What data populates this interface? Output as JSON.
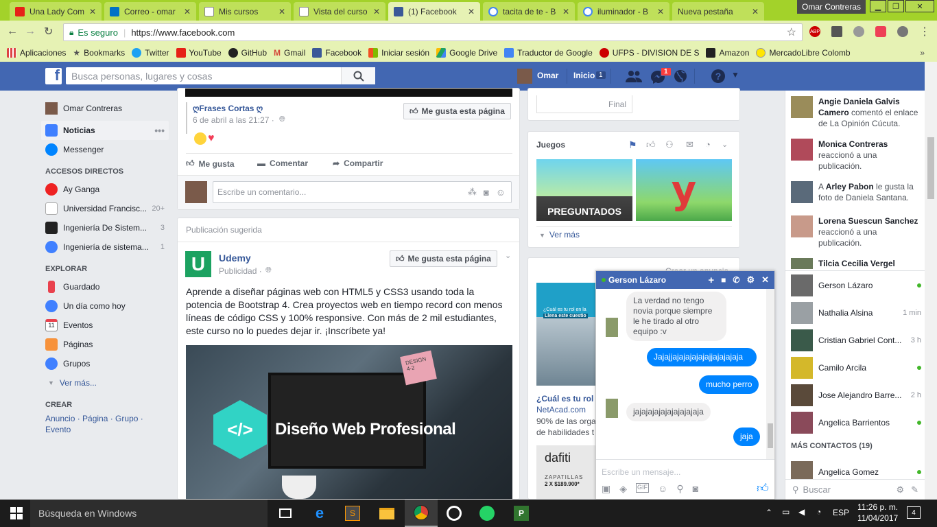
{
  "browser": {
    "tabs": [
      {
        "title": "Una Lady Com",
        "color": "#e62117"
      },
      {
        "title": "Correo - omar",
        "color": "#0072c6"
      },
      {
        "title": "Mis cursos",
        "color": "#ffffff"
      },
      {
        "title": "Vista del curso",
        "color": "#ffffff"
      },
      {
        "title": "(1) Facebook",
        "color": "#3b5998"
      },
      {
        "title": "tacita de te - B",
        "color": "#ffffff"
      },
      {
        "title": "iluminador - B",
        "color": "#ffffff"
      },
      {
        "title": "Nueva pestaña",
        "color": "#a3d22a"
      }
    ],
    "profile": "Omar Contreras",
    "secure_label": "Es seguro",
    "url": "https://www.facebook.com",
    "bookmarks": [
      {
        "label": "Aplicaciones",
        "color": "#d44"
      },
      {
        "label": "Bookmarks",
        "color": "#555"
      },
      {
        "label": "Twitter",
        "color": "#1da1f2"
      },
      {
        "label": "YouTube",
        "color": "#e62117"
      },
      {
        "label": "GitHub",
        "color": "#222"
      },
      {
        "label": "Gmail",
        "color": "#d44638"
      },
      {
        "label": "Facebook",
        "color": "#3b5998"
      },
      {
        "label": "Iniciar sesión",
        "color": "#f25022"
      },
      {
        "label": "Google Drive",
        "color": "#1fa463"
      },
      {
        "label": "Traductor de Google",
        "color": "#4285f4"
      },
      {
        "label": "UFPS - DIVISION DE S",
        "color": "#c00"
      },
      {
        "label": "Amazon",
        "color": "#222"
      },
      {
        "label": "MercadoLibre Colomb",
        "color": "#ffe600"
      }
    ]
  },
  "fb": {
    "search_placeholder": "Busca personas, lugares y cosas",
    "user": "Omar",
    "home": "Inicio",
    "home_count": "1",
    "msg_count": "1"
  },
  "leftnav": {
    "profile": "Omar Contreras",
    "news": "Noticias",
    "messenger": "Messenger",
    "shortcuts_title": "ACCESOS DIRECTOS",
    "shortcuts": [
      {
        "label": "Ay Ganga",
        "count": ""
      },
      {
        "label": "Universidad Francisc...",
        "count": "20+"
      },
      {
        "label": "Ingeniería De Sistem...",
        "count": "3"
      },
      {
        "label": "Ingeniería de sistema...",
        "count": "1"
      }
    ],
    "explore_title": "EXPLORAR",
    "explore": [
      {
        "label": "Guardado"
      },
      {
        "label": "Un día como hoy"
      },
      {
        "label": "Eventos"
      },
      {
        "label": "Páginas"
      },
      {
        "label": "Grupos"
      }
    ],
    "more": "Ver más...",
    "create_title": "CREAR",
    "create_links": "Anuncio · Página · Grupo · Evento"
  },
  "post1": {
    "page": "ღFrases Cortas ღ",
    "date": "6 de abril a las 21:27 ·",
    "like_page": "Me gusta esta página",
    "like": "Me gusta",
    "comment": "Comentar",
    "share": "Compartir",
    "comment_placeholder": "Escribe un comentario..."
  },
  "post2": {
    "label": "Publicación sugerida",
    "page": "Udemy",
    "sponsored": "Publicidad ·",
    "like_page": "Me gusta esta página",
    "text": "Aprende a diseñar páginas web con HTML5 y CSS3 usando toda la potencia de Bootstrap 4. Crea proyectos web en tiempo record con menos líneas de código CSS y 100% responsive. Con más de 2 mil estudiantes, este curso no lo puedes dejar ir. ¡Inscríbete ya!",
    "image_title": "Diseño Web Profesional",
    "sticky_note": "DESIGN 4-2"
  },
  "right": {
    "final_label": "Final",
    "games_title": "Juegos",
    "game1": "PREGUNTADOS",
    "game2": "y",
    "see_more": "Ver más",
    "create_ad": "Crear un anuncio",
    "ad_img_text1": "¿Cuál es tu rol en la",
    "ad_img_text2": "Llena este cuestio",
    "ad_title": "¿Cuál es tu rol",
    "ad_site": "NetAcad.com",
    "ad_desc1": "90% de las orga",
    "ad_desc2": "de habilidades t",
    "ad2_brand": "dafiti",
    "ad2_line1": "ZAPATILLAS",
    "ad2_line2": "2 X $189.900*"
  },
  "activity": [
    {
      "name": "Angie Daniela Galvis Camero",
      "text": " comentó el enlace de La Opinión Cúcuta."
    },
    {
      "name": "Monica Contreras",
      "text": " reaccionó a una publicación."
    },
    {
      "pre": "A ",
      "name": "Arley Pabon",
      "text": " le gusta la foto de Daniela Santana."
    },
    {
      "name": "Lorena Suescun Sanchez",
      "text": " reaccionó a una publicación."
    },
    {
      "name": "Tilcia Cecilia Vergel",
      "text": ""
    }
  ],
  "contacts": [
    {
      "name": "Gerson Lázaro",
      "status": "online"
    },
    {
      "name": "Nathalia Alsina",
      "status": "1 min"
    },
    {
      "name": "Cristian Gabriel Cont...",
      "status": "3 h"
    },
    {
      "name": "Camilo Arcila",
      "status": "online"
    },
    {
      "name": "Jose Alejandro Barre...",
      "status": "2 h"
    },
    {
      "name": "Angelica Barrientos",
      "status": "online"
    }
  ],
  "more_contacts_title": "MÁS CONTACTOS (19)",
  "more_contacts": [
    {
      "name": "Angelica Gomez",
      "status": "online"
    }
  ],
  "chat_search": "Buscar",
  "chat": {
    "name": "Gerson Lázaro",
    "messages": [
      {
        "from": "in",
        "text": "La verdad no tengo novia porque siempre le he tirado al otro equipo :v"
      },
      {
        "from": "out",
        "text": "Jajajjajajajajajajjajajajaja"
      },
      {
        "from": "out",
        "text": "mucho perro"
      },
      {
        "from": "in",
        "text": "jajajajajajajajajajaja"
      },
      {
        "from": "out",
        "text": "jaja"
      }
    ],
    "input_placeholder": "Escribe un mensaje..."
  },
  "taskbar": {
    "search": "Búsqueda en Windows",
    "lang": "ESP",
    "time": "11:26 p. m.",
    "date": "11/04/2017",
    "notif": "4"
  }
}
